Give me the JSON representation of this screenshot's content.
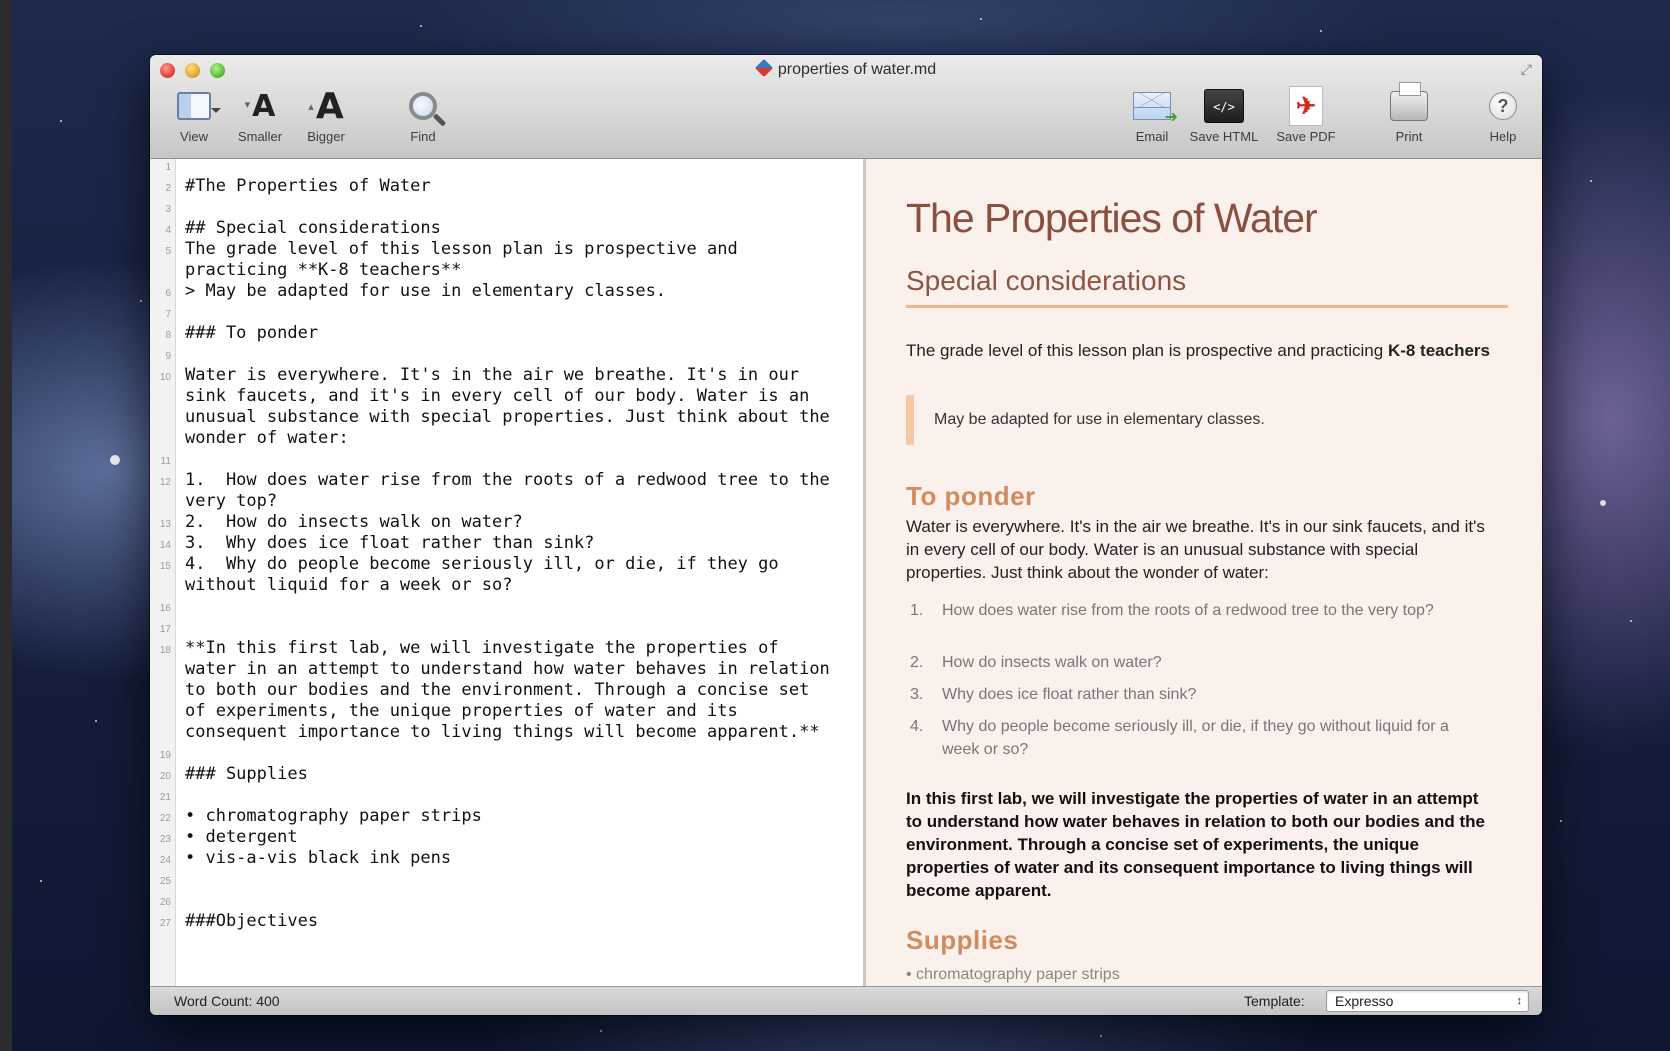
{
  "window": {
    "title": "properties of water.md"
  },
  "toolbar": {
    "view": "View",
    "smaller": "Smaller",
    "bigger": "Bigger",
    "find": "Find",
    "email": "Email",
    "save_html": "Save HTML",
    "save_pdf": "Save PDF",
    "print": "Print",
    "help": "Help",
    "html_glyph": "</>",
    "help_glyph": "?"
  },
  "editor": {
    "line_numbers": [
      "1",
      "2",
      "3",
      "4",
      "5",
      "6",
      "7",
      "8",
      "9",
      "10",
      "11",
      "12",
      "13",
      "14",
      "15",
      "16",
      "17",
      "18",
      "19",
      "20",
      "21",
      "22",
      "23",
      "24",
      "25",
      "26",
      "27"
    ],
    "lines": [
      "#The Properties of Water",
      "## Special considerations",
      "The grade level of this lesson plan is prospective and",
      "practicing **K-8 teachers**",
      "> May be adapted for use in elementary classes.",
      "### To ponder",
      "Water is everywhere. It's in the air we breathe. It's in our",
      "sink faucets, and it's in every cell of our body. Water is an",
      "unusual substance with special properties. Just think about the",
      "wonder of water:",
      "1.  How does water rise from the roots of a redwood tree to the",
      "very top?",
      "2.  How do insects walk on water?",
      "3.  Why does ice float rather than sink?",
      "4.  Why do people become seriously ill, or die, if they go",
      "without liquid for a week or so?",
      "**In this first lab, we will investigate the properties of",
      "water in an attempt to understand how water behaves in relation",
      "to both our bodies and the environment. Through a concise set",
      "of experiments, the unique properties of water and its",
      "consequent importance to living things will become apparent.**",
      "### Supplies",
      "• chromatography paper strips",
      "• detergent",
      "• vis-a-vis black ink pens",
      "###Objectives"
    ]
  },
  "preview": {
    "h1": "The Properties of Water",
    "h2": "Special considerations",
    "p1_text": "The grade level of this lesson plan is prospective and practicing ",
    "p1_bold": "K-8 teachers",
    "blockquote": "May be adapted for use in elementary classes.",
    "h3_ponder": "To ponder",
    "p2": "Water is everywhere. It's in the air we breathe. It's in our sink faucets, and it's in every cell of our body. Water is an unusual substance with special properties. Just think about the wonder of water:",
    "list": [
      {
        "num": "1.",
        "text": "How does water rise from the roots of a redwood tree to the very top?"
      },
      {
        "num": "2.",
        "text": "How do insects walk on water?"
      },
      {
        "num": "3.",
        "text": "Why does ice float rather than sink?"
      },
      {
        "num": "4.",
        "text": "Why do people become seriously ill, or die, if they go without liquid for a week or so?"
      }
    ],
    "bold_para": "In this first lab, we will investigate the properties of water in an attempt to understand how water behaves in relation to both our bodies and the environment. Through a concise set of experiments, the unique properties of water and its consequent importance to living things will become apparent.",
    "h3_supplies": "Supplies",
    "supplies_first": "• chromatography paper strips"
  },
  "status": {
    "word_count": "Word Count: 400",
    "template_label": "Template:",
    "template_value": "Expresso",
    "select_arrows": "↕"
  },
  "colors": {
    "heading_brown": "#8a4f3e",
    "accent_orange": "#d28a5f",
    "rule_peach": "#f3b487",
    "preview_bg": "#fbf1ec"
  }
}
